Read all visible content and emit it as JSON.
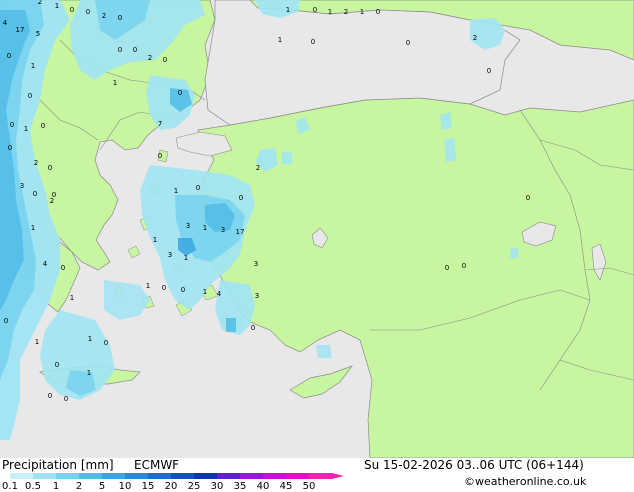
{
  "legend": {
    "title": "Precipitation [mm]",
    "model": "ECMWF",
    "datetime": "Su 15-02-2026 03..06 UTC (06+144)",
    "credit": "©weatheronline.co.uk",
    "ticks": [
      "0.1",
      "0.5",
      "1",
      "2",
      "5",
      "10",
      "15",
      "20",
      "25",
      "30",
      "35",
      "40",
      "45",
      "50"
    ],
    "colors": [
      "#c8f0f8",
      "#a0e4f4",
      "#78d2ee",
      "#50bce8",
      "#38a4e0",
      "#2a88d8",
      "#1e6cd0",
      "#1450c0",
      "#0c36b0",
      "#6020d0",
      "#9a18d8",
      "#c810d8",
      "#e80cc8",
      "#f020b0"
    ]
  },
  "map": {
    "land_color": "#c8f5a0",
    "sea_color": "#e8e8e8",
    "border_color": "#8a8a8a",
    "values": [
      {
        "t": "4"
      },
      {
        "t": "2"
      },
      {
        "t": "1"
      },
      {
        "t": "0"
      },
      {
        "t": "0"
      },
      {
        "t": "2"
      },
      {
        "t": "0"
      },
      {
        "t": "17"
      },
      {
        "t": "5"
      },
      {
        "t": "0"
      },
      {
        "t": "1"
      },
      {
        "t": "0"
      },
      {
        "t": "0"
      },
      {
        "t": "2"
      },
      {
        "t": "0"
      },
      {
        "t": "1"
      },
      {
        "t": "0"
      },
      {
        "t": "0"
      },
      {
        "t": "1"
      },
      {
        "t": "0"
      },
      {
        "t": "0"
      },
      {
        "t": "2"
      },
      {
        "t": "0"
      },
      {
        "t": "7"
      },
      {
        "t": "0"
      },
      {
        "t": "0"
      },
      {
        "t": "2"
      },
      {
        "t": "3"
      },
      {
        "t": "2"
      },
      {
        "t": "0"
      },
      {
        "t": "0"
      },
      {
        "t": "1"
      },
      {
        "t": "0"
      },
      {
        "t": "3"
      },
      {
        "t": "1"
      },
      {
        "t": "1"
      },
      {
        "t": "0"
      },
      {
        "t": "1"
      },
      {
        "t": "3"
      },
      {
        "t": "17"
      },
      {
        "t": "3"
      },
      {
        "t": "1"
      },
      {
        "t": "4"
      },
      {
        "t": "0"
      },
      {
        "t": "3"
      },
      {
        "t": "1"
      },
      {
        "t": "0"
      },
      {
        "t": "0"
      },
      {
        "t": "1"
      },
      {
        "t": "4"
      },
      {
        "t": "1"
      },
      {
        "t": "3"
      },
      {
        "t": "0"
      },
      {
        "t": "1"
      },
      {
        "t": "0"
      },
      {
        "t": "1"
      },
      {
        "t": "0"
      },
      {
        "t": "0"
      },
      {
        "t": "1"
      },
      {
        "t": "0"
      },
      {
        "t": "0"
      },
      {
        "t": "2"
      },
      {
        "t": "1"
      },
      {
        "t": "0"
      },
      {
        "t": "1"
      },
      {
        "t": "0"
      },
      {
        "t": "1"
      },
      {
        "t": "2"
      },
      {
        "t": "1"
      },
      {
        "t": "0"
      },
      {
        "t": "0"
      },
      {
        "t": "0"
      },
      {
        "t": "0"
      },
      {
        "t": "0"
      },
      {
        "t": "0"
      }
    ]
  }
}
